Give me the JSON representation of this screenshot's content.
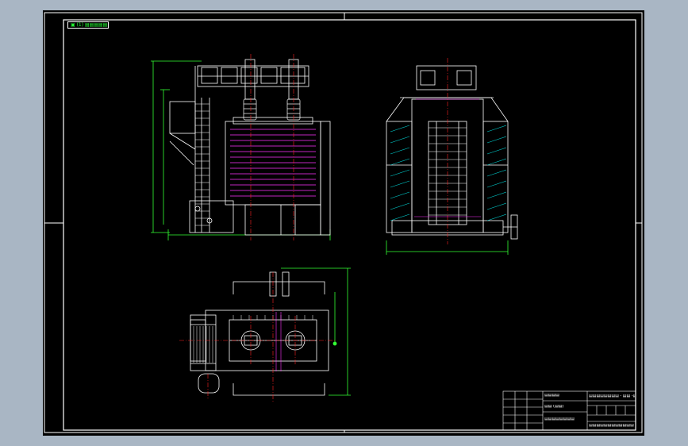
{
  "sheet": {
    "corner_tag": "▣ (1) ▤▤▤▤▤▤",
    "title_block": {
      "company": "▤▤▤▤",
      "drawing_number": "▤▤▤▤▤▤▤▤ - ▤▤ -▤▤",
      "drawing_name": "▤▤ (▤▤)",
      "project": "▤▤▤▤▤▤▤▤",
      "footer": "▤▤▤▤▤▤▤▤▤▤▤▤"
    }
  },
  "colors": {
    "background": "#000000",
    "frame": "#ffffff",
    "dimension": "#33ff33",
    "centerline": "#ff2222",
    "plates": "#ff33ff",
    "hatch": "#00cccc",
    "annotations": "#ffff33"
  }
}
